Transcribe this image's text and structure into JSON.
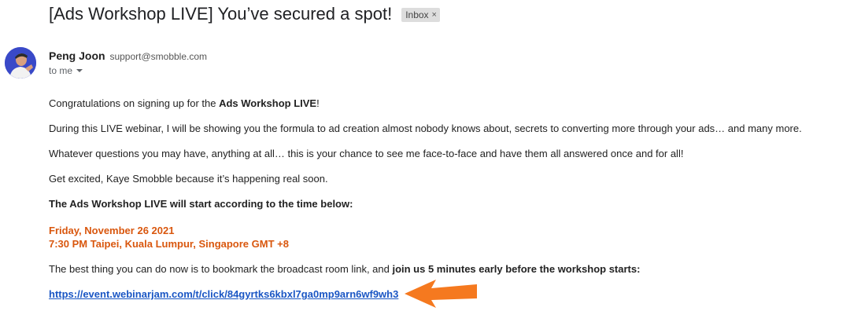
{
  "email": {
    "subject": "[Ads Workshop LIVE] You’ve secured a spot!",
    "label": "Inbox",
    "label_remove": "×"
  },
  "sender": {
    "name": "Peng Joon",
    "email": "support@smobble.com",
    "recipient": "to me"
  },
  "body": {
    "p1_pre": "Congratulations on signing up for the ",
    "p1_bold": "Ads Workshop LIVE",
    "p1_post": "!",
    "p2": "During this LIVE webinar, I will be showing you the formula to ad creation almost nobody knows about, secrets to converting more through your ads… and many more.",
    "p3": "Whatever questions you may have, anything at all… this is your chance to see me face-to-face and have them all answered once and for all!",
    "p4": "Get excited, Kaye Smobble because it’s happening real soon.",
    "p5": "The Ads Workshop LIVE will start according to the time below:",
    "date": "Friday, November 26 2021",
    "time": "7:30 PM Taipei, Kuala Lumpur, Singapore GMT +8",
    "p6_pre": "The best thing you can do now is to bookmark the broadcast room link, and ",
    "p6_bold": "join us 5 minutes early before the workshop starts:",
    "link": "https://event.webinarjam.com/t/click/84gyrtks6kbxl7ga0mp9arn6wf9wh3"
  },
  "colors": {
    "highlight": "#d9570e",
    "link": "#1a56c4",
    "arrow": "#f5791f"
  }
}
